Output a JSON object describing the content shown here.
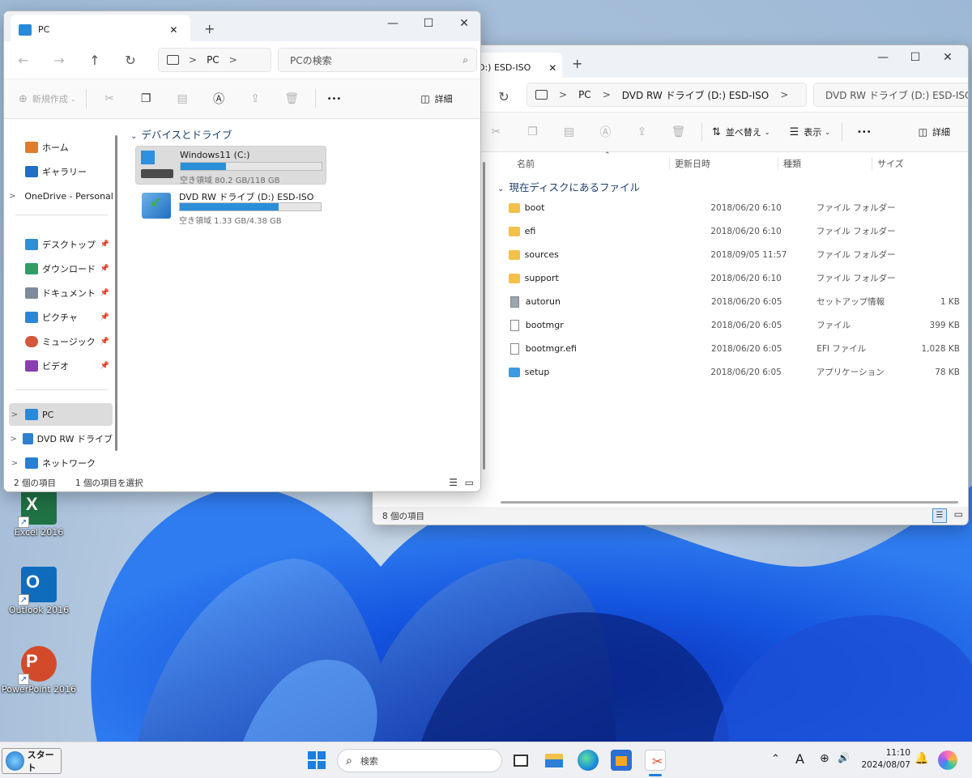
{
  "desktop_icons": [
    {
      "label": "Excel 2016",
      "glyph": "X",
      "color": "#1f7244",
      "icon": "excel-icon"
    },
    {
      "label": "Outlook 2016",
      "glyph": "O",
      "color": "#0f6cbd",
      "icon": "outlook-icon"
    },
    {
      "label": "PowerPoint 2016",
      "glyph": "P",
      "color": "#d34a2a",
      "icon": "powerpoint-icon"
    }
  ],
  "window_pc": {
    "tab_title": "PC",
    "new_tab": "+",
    "controls": {
      "minimize": "—",
      "maximize": "☐",
      "close": "✕"
    },
    "nav": {
      "back": "←",
      "forward": "→",
      "up": "↑",
      "refresh": "↻"
    },
    "address": {
      "root": "PC",
      "sep": ">"
    },
    "search_placeholder": "PCの検索",
    "toolbar": {
      "new_label": "新規作成",
      "details_label": "詳細",
      "more": "•••"
    },
    "sidebar": {
      "items": [
        {
          "label": "ホーム",
          "icon": "home-icon",
          "color": "#e07d2b"
        },
        {
          "label": "ギャラリー",
          "icon": "gallery-icon",
          "color": "#1f6fc4"
        },
        {
          "label": "OneDrive - Personal",
          "icon": "onedrive-icon",
          "color": "#2a76c7"
        },
        {
          "label": "デスクトップ",
          "icon": "desktop-icon",
          "color": "#2f8fd8"
        },
        {
          "label": "ダウンロード",
          "icon": "download-icon",
          "color": "#2e9e64"
        },
        {
          "label": "ドキュメント",
          "icon": "documents-icon",
          "color": "#7d8b9c"
        },
        {
          "label": "ピクチャ",
          "icon": "pictures-icon",
          "color": "#2a86d6"
        },
        {
          "label": "ミュージック",
          "icon": "music-icon",
          "color": "#d4573b"
        },
        {
          "label": "ビデオ",
          "icon": "video-icon",
          "color": "#8a3fb0"
        },
        {
          "label": "PC",
          "icon": "pc-icon",
          "color": "#2889d8"
        },
        {
          "label": "DVD RW ドライブ",
          "icon": "dvd-icon",
          "color": "#2f7fcf"
        },
        {
          "label": "ネットワーク",
          "icon": "network-icon",
          "color": "#2a7fd0"
        }
      ]
    },
    "section_title": "デバイスとドライブ",
    "drives": [
      {
        "name": "Windows11 (C:)",
        "free_text": "空き領域 80.2 GB/118 GB",
        "used_fraction": 0.32
      },
      {
        "name": "DVD RW ドライブ (D:) ESD-ISO",
        "free_text": "空き領域 1.33 GB/4.38 GB",
        "used_fraction": 0.7
      }
    ],
    "status": {
      "count": "2 個の項目",
      "selected": "1 個の項目を選択"
    }
  },
  "window_dvd": {
    "tab_title": "D:) ESD-ISO",
    "new_tab": "+",
    "controls": {
      "minimize": "—",
      "maximize": "☐",
      "close": "✕"
    },
    "breadcrumb": [
      "PC",
      "DVD RW ドライブ (D:) ESD-ISO"
    ],
    "search_placeholder": "DVD RW ドライブ (D:) ESD-ISOの",
    "toolbar": {
      "sort_label": "並べ替え",
      "view_label": "表示",
      "details_label": "詳細",
      "more": "•••"
    },
    "columns": [
      "名前",
      "更新日時",
      "種類",
      "サイズ"
    ],
    "group_title": "現在ディスクにあるファイル",
    "files": [
      {
        "name": "boot",
        "date": "2018/06/20 6:10",
        "type": "ファイル フォルダー",
        "size": "",
        "icon": "folder-icon"
      },
      {
        "name": "efi",
        "date": "2018/06/20 6:10",
        "type": "ファイル フォルダー",
        "size": "",
        "icon": "folder-icon"
      },
      {
        "name": "sources",
        "date": "2018/09/05 11:57",
        "type": "ファイル フォルダー",
        "size": "",
        "icon": "folder-icon"
      },
      {
        "name": "support",
        "date": "2018/06/20 6:10",
        "type": "ファイル フォルダー",
        "size": "",
        "icon": "folder-icon"
      },
      {
        "name": "autorun",
        "date": "2018/06/20 6:05",
        "type": "セットアップ情報",
        "size": "1 KB",
        "icon": "settings-file-icon"
      },
      {
        "name": "bootmgr",
        "date": "2018/06/20 6:05",
        "type": "ファイル",
        "size": "399 KB",
        "icon": "file-icon"
      },
      {
        "name": "bootmgr.efi",
        "date": "2018/06/20 6:05",
        "type": "EFI ファイル",
        "size": "1,028 KB",
        "icon": "file-icon"
      },
      {
        "name": "setup",
        "date": "2018/06/20 6:05",
        "type": "アプリケーション",
        "size": "78 KB",
        "icon": "setup-app-icon"
      }
    ],
    "status": {
      "count": "8 個の項目"
    }
  },
  "taskbar": {
    "start_label": "スタート",
    "search_placeholder": "検索",
    "ime": "A",
    "time": "11:10",
    "date": "2024/08/07"
  },
  "colors": {
    "accent": "#2b8fd8",
    "folder": "#f3c04a",
    "selection": "#dcdcdc"
  }
}
